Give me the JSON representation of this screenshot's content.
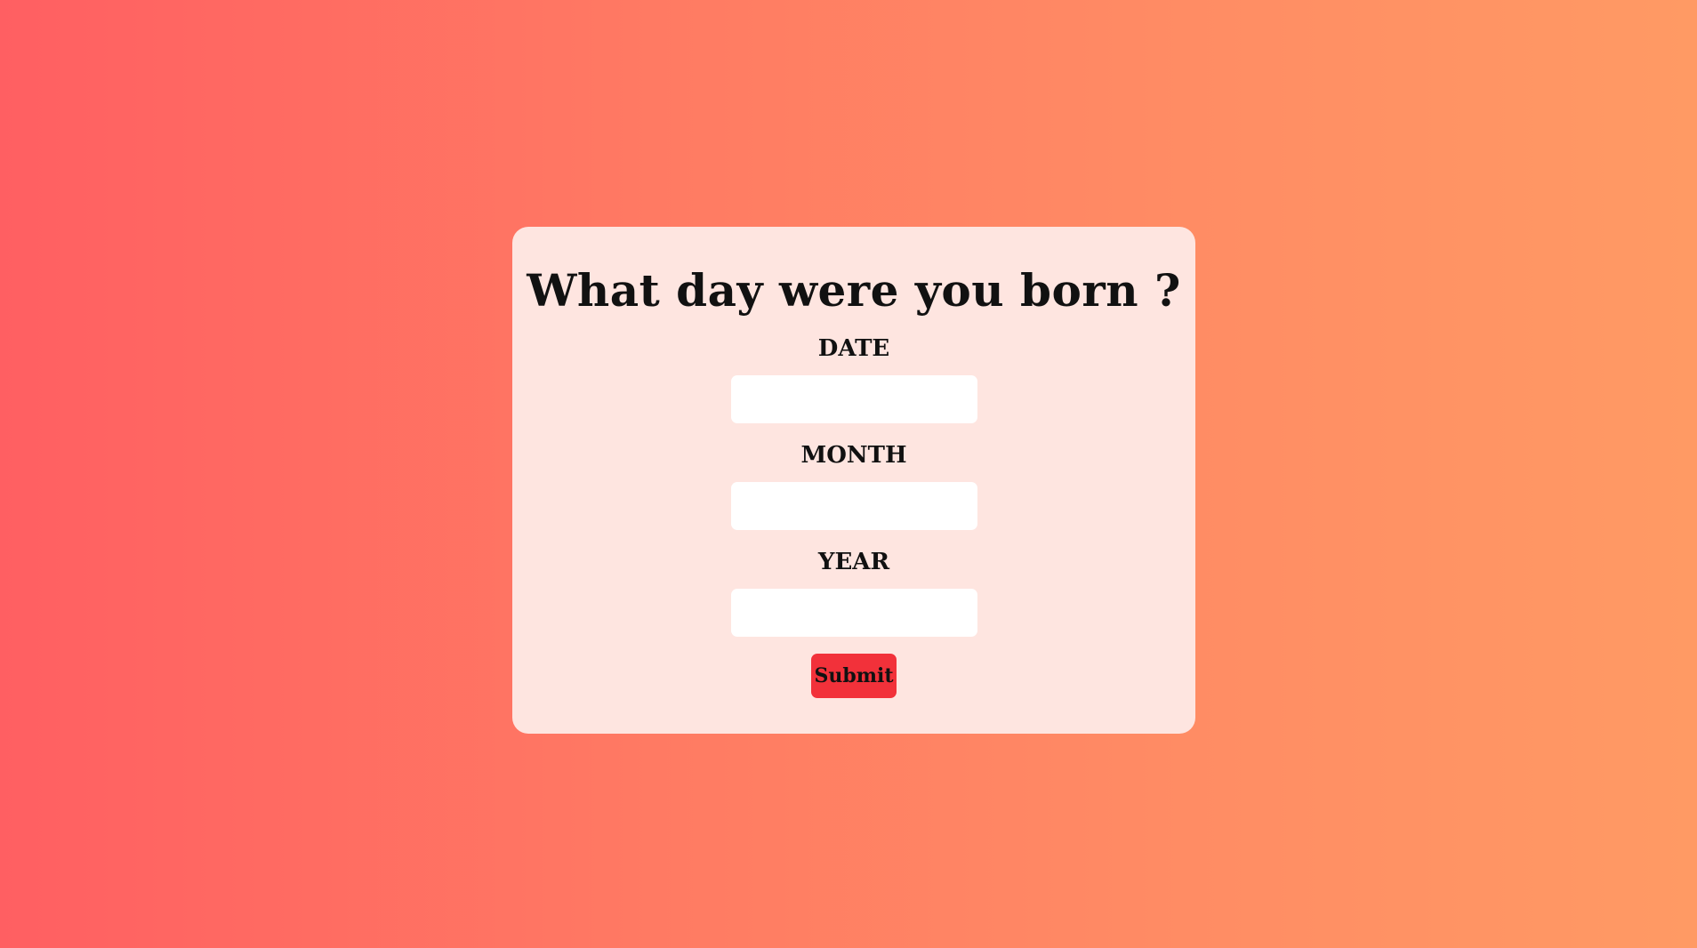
{
  "form": {
    "title": "What day were you born ?",
    "fields": [
      {
        "label": "DATE",
        "value": "",
        "placeholder": ""
      },
      {
        "label": "MONTH",
        "value": "",
        "placeholder": ""
      },
      {
        "label": "YEAR",
        "value": "",
        "placeholder": ""
      }
    ],
    "submit_label": "Submit"
  },
  "colors": {
    "background_gradient_start": "#ff5f62",
    "background_gradient_end": "#ff9a64",
    "card_background": "#fee5e0",
    "input_background": "#ffffff",
    "submit_background": "#f2313a",
    "text": "#111111"
  }
}
